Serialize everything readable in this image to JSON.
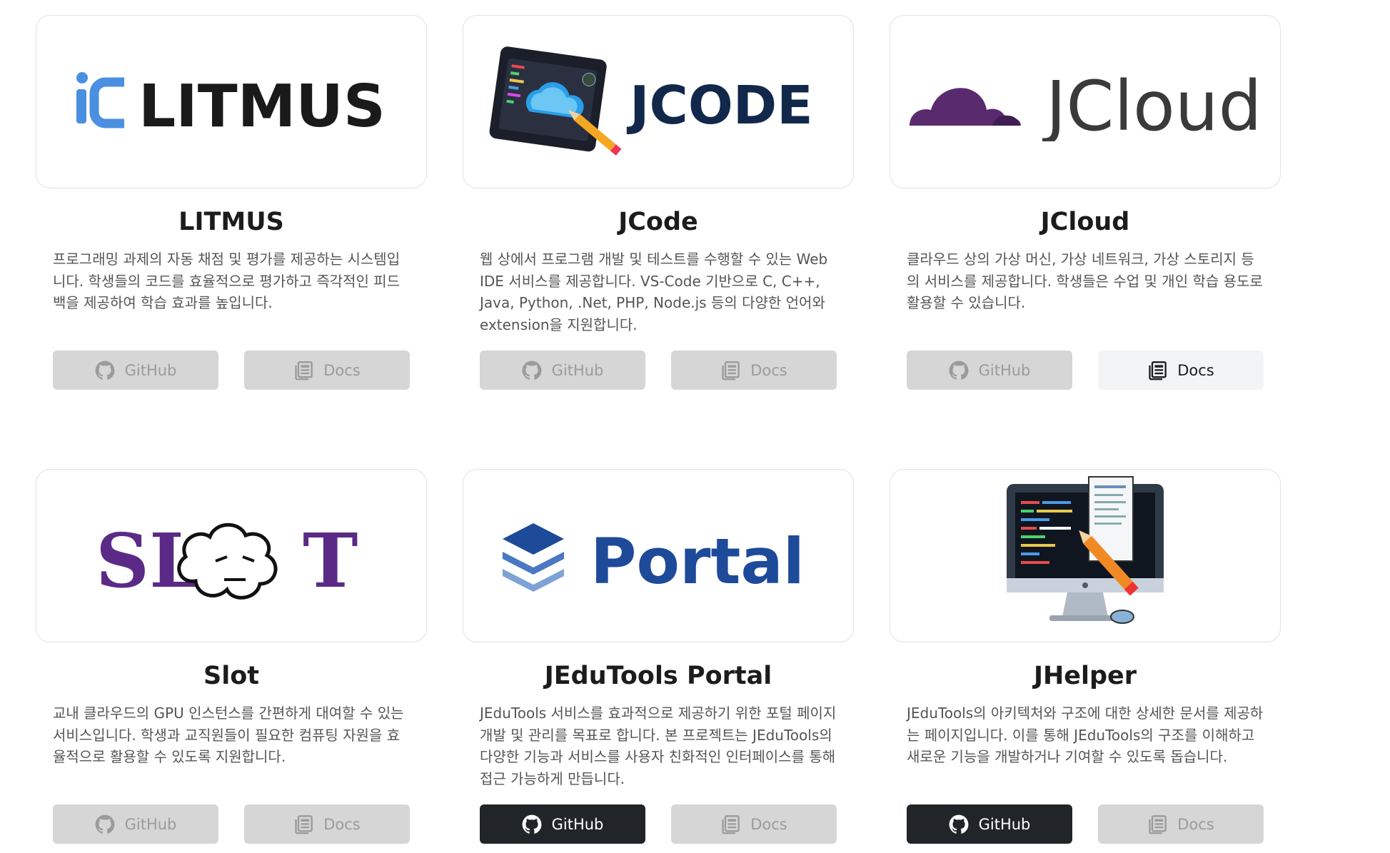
{
  "cards": [
    {
      "title": "LITMUS",
      "logo_text": "LITMUS",
      "logo_mark": "iC",
      "description": "프로그래밍 과제의 자동 채점 및 평가를 제공하는 시스템입니다. 학생들의 코드를 효율적으로 평가하고 즉각적인 피드백을 제공하여 학습 효과를 높입니다.",
      "github": {
        "label": "GitHub",
        "state": "disabled"
      },
      "docs": {
        "label": "Docs",
        "state": "disabled"
      }
    },
    {
      "title": "JCode",
      "logo_text": "JCODE",
      "description": "웹 상에서 프로그램 개발 및 테스트를 수행할 수 있는 Web IDE 서비스를 제공합니다. VS-Code 기반으로 C, C++, Java, Python, .Net, PHP, Node.js 등의 다양한 언어와 extension을 지원합니다.",
      "github": {
        "label": "GitHub",
        "state": "disabled"
      },
      "docs": {
        "label": "Docs",
        "state": "disabled"
      }
    },
    {
      "title": "JCloud",
      "logo_text": "JCloud",
      "description": "클라우드 상의 가상 머신, 가상 네트워크, 가상 스토리지 등의 서비스를 제공합니다. 학생들은 수업 및 개인 학습 용도로 활용할 수 있습니다.",
      "github": {
        "label": "GitHub",
        "state": "disabled"
      },
      "docs": {
        "label": "Docs",
        "state": "active"
      }
    },
    {
      "title": "Slot",
      "logo_text": "SL",
      "logo_text_end": "T",
      "description": "교내 클라우드의 GPU 인스턴스를 간편하게 대여할 수 있는 서비스입니다. 학생과 교직원들이 필요한 컴퓨팅 자원을 효율적으로 활용할 수 있도록 지원합니다.",
      "github": {
        "label": "GitHub",
        "state": "disabled"
      },
      "docs": {
        "label": "Docs",
        "state": "disabled"
      }
    },
    {
      "title": "JEduTools Portal",
      "logo_text": "Portal",
      "description": "JEduTools 서비스를 효과적으로 제공하기 위한 포털 페이지 개발 및 관리를 목표로 합니다. 본 프로젝트는 JEduTools의 다양한 기능과 서비스를 사용자 친화적인 인터페이스를 통해 접근 가능하게 만듭니다.",
      "github": {
        "label": "GitHub",
        "state": "active"
      },
      "docs": {
        "label": "Docs",
        "state": "disabled"
      }
    },
    {
      "title": "JHelper",
      "description": "JEduTools의 아키텍처와 구조에 대한 상세한 문서를 제공하는 페이지입니다. 이를 통해 JEduTools의 구조를 이해하고 새로운 기능을 개발하거나 기여할 수 있도록 돕습니다.",
      "github": {
        "label": "GitHub",
        "state": "active"
      },
      "docs": {
        "label": "Docs",
        "state": "disabled"
      }
    }
  ],
  "colors": {
    "litmus_blue": "#4a8fe0",
    "jcode_navy": "#12284a",
    "jcloud_purple": "#5a2a6e",
    "slot_purple": "#5b2a86",
    "portal_blue": "#1e4a9a",
    "button_disabled": "#d6d6d6",
    "button_dark": "#212429",
    "button_light": "#f3f4f6"
  },
  "icons": {
    "github": "github-icon",
    "docs": "docs-icon"
  }
}
